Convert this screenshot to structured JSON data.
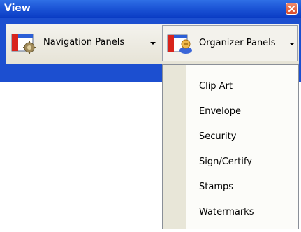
{
  "window": {
    "title": "View"
  },
  "toolbar": {
    "navigation_label": "Navigation Panels",
    "organizer_label": "Organizer Panels"
  },
  "menu": {
    "items": [
      {
        "label": "Clip Art"
      },
      {
        "label": "Envelope"
      },
      {
        "label": "Security"
      },
      {
        "label": "Sign/Certify"
      },
      {
        "label": "Stamps"
      },
      {
        "label": "Watermarks"
      }
    ]
  },
  "icons": {
    "navigation": "navigation-panels-icon",
    "organizer": "organizer-panels-icon",
    "close": "close-icon",
    "dropdown": "dropdown-arrow-icon"
  },
  "colors": {
    "titlebar": "#1c55d6",
    "toolbar_bg": "#1c4fd0",
    "close_button": "#d84a2a",
    "menu_gutter": "#e8e6d8"
  }
}
